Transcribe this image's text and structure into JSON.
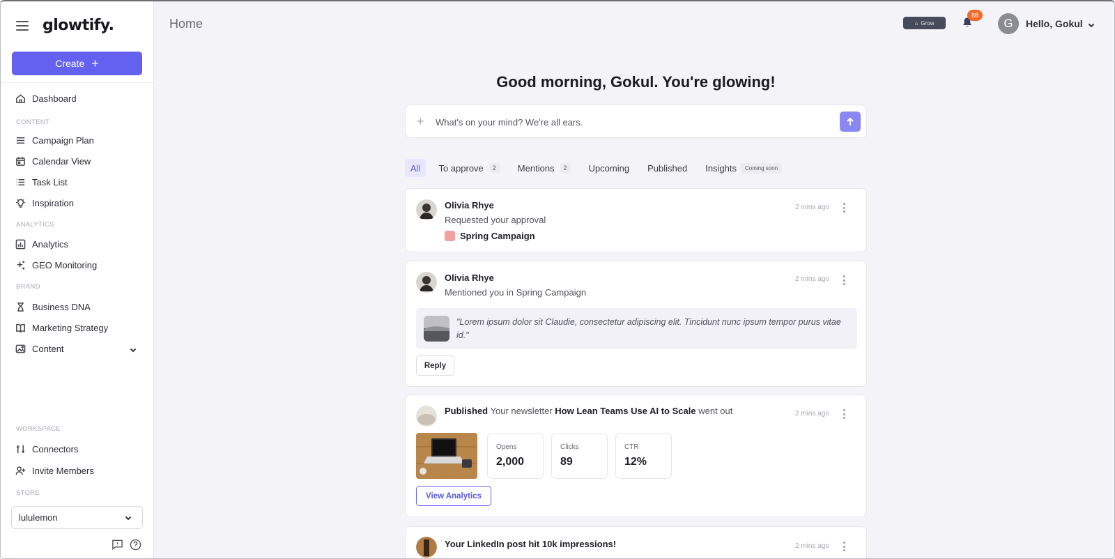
{
  "app": {
    "logo": "glowtify."
  },
  "sidebar": {
    "create_label": "Create",
    "dashboard": "Dashboard",
    "sections": {
      "content": "CONTENT",
      "analytics": "ANALYTICS",
      "brand": "BRAND",
      "workspace": "WORKSPACE",
      "store": "STORE"
    },
    "items": {
      "campaign_plan": "Campaign Plan",
      "calendar_view": "Calendar View",
      "task_list": "Task List",
      "inspiration": "Inspiration",
      "analytics": "Analytics",
      "geo_monitoring": "GEO Monitoring",
      "business_dna": "Business DNA",
      "marketing_strategy": "Marketing Strategy",
      "content": "Content",
      "connectors": "Connectors",
      "invite_members": "Invite Members"
    },
    "store_value": "lululemon"
  },
  "header": {
    "title": "Home",
    "grow_label": "Grow",
    "notification_count": "88",
    "user_initial": "G",
    "user_greeting": "Hello, Gokul"
  },
  "main": {
    "headline": "Good morning, Gokul. You're glowing!",
    "composer_placeholder": "What's on your mind? We're all ears.",
    "tabs": {
      "all": "All",
      "to_approve": "To approve",
      "to_approve_count": "2",
      "mentions": "Mentions",
      "mentions_count": "2",
      "upcoming": "Upcoming",
      "published": "Published",
      "insights": "Insights",
      "insights_badge": "Coming soon"
    },
    "cards": {
      "approval": {
        "name": "Olivia Rhye",
        "text": "Requested your approval",
        "campaign": "Spring Campaign",
        "time": "2 mins ago"
      },
      "mention": {
        "name": "Olivia Rhye",
        "text": "Mentioned you in Spring Campaign",
        "quote": "\"Lorem ipsum dolor sit Claudie, consectetur adipiscing elit. Tincidunt nunc ipsum tempor purus vitae id.\"",
        "reply_label": "Reply",
        "time": "2 mins ago"
      },
      "published": {
        "status": "Published",
        "text_before": "Your newsletter",
        "title": "How Lean Teams Use AI to Scale",
        "text_after": "went out",
        "time": "2 mins ago",
        "stats": {
          "opens_label": "Opens",
          "opens_value": "2,000",
          "clicks_label": "Clicks",
          "clicks_value": "89",
          "ctr_label": "CTR",
          "ctr_value": "12%"
        },
        "view_label": "View Analytics"
      },
      "linkedin": {
        "text": "Your LinkedIn post hit 10k impressions!",
        "time": "2 mins ago"
      }
    }
  },
  "colors": {
    "accent": "#6461f1",
    "badge": "#f26a2b",
    "tag": "#f4a0a0"
  }
}
